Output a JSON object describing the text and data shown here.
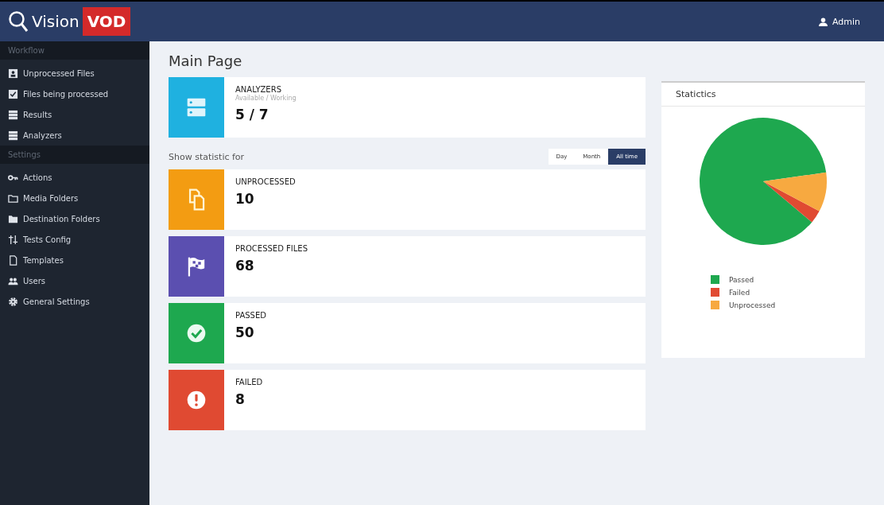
{
  "header": {
    "logo_text": "Vision",
    "logo_badge": "VOD",
    "user": "Admin"
  },
  "sidebar": {
    "sections": [
      {
        "title": "Workflow",
        "items": [
          {
            "label": "Unprocessed Files",
            "kind": "card",
            "selected": false
          },
          {
            "label": "Files being processed",
            "kind": "checked",
            "selected": false
          },
          {
            "label": "Results",
            "kind": "list",
            "selected": false
          },
          {
            "label": "Analyzers",
            "kind": "list",
            "selected": false
          }
        ]
      },
      {
        "title": "Settings",
        "items": [
          {
            "label": "Actions",
            "kind": "key",
            "selected": false
          },
          {
            "label": "Media Folders",
            "kind": "folder",
            "selected": false
          },
          {
            "label": "Destination Folders",
            "kind": "folders",
            "selected": false
          },
          {
            "label": "Tests Config",
            "kind": "config",
            "selected": false
          },
          {
            "label": "Templates",
            "kind": "file",
            "selected": false
          },
          {
            "label": "Users",
            "kind": "users",
            "selected": false
          },
          {
            "label": "General Settings",
            "kind": "gear",
            "selected": false
          }
        ]
      }
    ]
  },
  "page_title": "Main Page",
  "analyzers": {
    "title": "ANALYZERS",
    "subtitle": "Available / Working",
    "value": "5 / 7"
  },
  "filter": {
    "label": "Show statistic for",
    "options": [
      {
        "label": "Day",
        "selected": false
      },
      {
        "label": "Month",
        "selected": false
      },
      {
        "label": "All time",
        "selected": true
      }
    ]
  },
  "stats": [
    {
      "kind": "unprocessed",
      "title": "UNPROCESSED",
      "value": "10",
      "color": "#f39c12"
    },
    {
      "kind": "processed",
      "title": "PROCESSED FILES",
      "value": "68",
      "color": "#5b4fb0"
    },
    {
      "kind": "passed",
      "title": "PASSED",
      "value": "50",
      "color": "#1ea84f"
    },
    {
      "kind": "failed",
      "title": "FAILED",
      "value": "8",
      "color": "#e04a32"
    }
  ],
  "statistics": {
    "title": "Statictics",
    "legend": [
      {
        "label": "Passed",
        "color": "#1ea84f"
      },
      {
        "label": "Failed",
        "color": "#e04a32"
      },
      {
        "label": "Unprocessed",
        "color": "#f7a940"
      }
    ]
  }
}
